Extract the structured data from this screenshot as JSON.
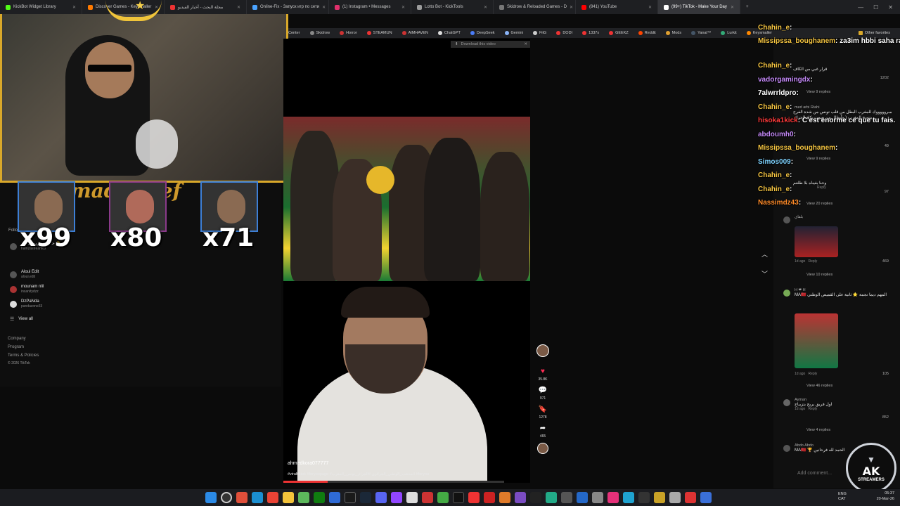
{
  "browser": {
    "tabs": [
      {
        "label": "KickBot Widget Library",
        "color": "#53fc18"
      },
      {
        "label": "Discover Games - Keysmaller",
        "color": "#ff7a00"
      },
      {
        "label": "مجلة البحث - أخبار الفيديو",
        "color": "#e33"
      },
      {
        "label": "Online-Fix - Запуск игр по сети",
        "color": "#4aa3ff"
      },
      {
        "label": "(1) Instagram • Messages",
        "color": "#e1306c"
      },
      {
        "label": "Lotto Bot - KickTools",
        "color": "#9c9c9c"
      },
      {
        "label": "Skidrow & Reloaded Games - D",
        "color": "#777"
      },
      {
        "label": "(841) YouTube",
        "color": "#ff0000"
      },
      {
        "label": "(99+) TikTok - Make Your Day",
        "color": "#ffffff"
      }
    ],
    "new_tab": "+",
    "bookmarks": [
      "Center",
      "Skidrow",
      "Horror",
      "STEAMUN",
      "AIMHAVEN",
      "ChatGPT",
      "DeepSeek",
      "Gemini",
      "FitG",
      "DODI",
      "1337x",
      "GEEKZ",
      "Reddit",
      "Mods",
      "Yanal™",
      "Lurkit",
      "Keysmaller",
      "Other favorites"
    ]
  },
  "tiktok_nav": {
    "following_heading": "Follo",
    "accounts": [
      {
        "name": "حمزة ستريم ستايل ✨",
        "handle": "hamzastreamdz"
      },
      {
        "name": "Aloui Edit",
        "handle": "aloui.edit"
      },
      {
        "name": "mounam nlil",
        "handle": "insanitydzz"
      },
      {
        "name": "DzPaNda",
        "handle": "pandazone33"
      }
    ],
    "view_all": "View all",
    "footer": [
      "Company",
      "Program",
      "Terms & Policies",
      "© 2026 TikTok"
    ]
  },
  "overlay": {
    "banner_text": "mad  areef",
    "multipliers": [
      "x99",
      "x80",
      "x71"
    ]
  },
  "video": {
    "download_banner": "Download this video",
    "author": "ahmedkora077777",
    "caption": "#viraltiktok #foryoupage #المنتخب_الوطني_الجزائري #الجزائر_تونس_المغرب #foryou"
  },
  "actions": {
    "likes": "35.8K",
    "comments": "971",
    "saves": "1278",
    "shares": "465"
  },
  "comments": {
    "items": [
      {
        "text": "قرار غبي من الكاف",
        "likes": "1202",
        "reply": "Reply"
      },
      {
        "text": "",
        "likes": "",
        "reply": "View 9 replies"
      },
      {
        "who": "med arbi Riahi",
        "text": "مبروووووك للمغرب البطل من قلب تونس من شدة الفرح بتتويج المغرب ( وأبطال من صوت بكاء الجزائر",
        "likes": "49",
        "reply": "View 9 replies"
      },
      {
        "text": "وحنا بغيناه بلا طلعم",
        "likes": "97",
        "reply": "Reply"
      },
      {
        "text": "",
        "likes": "",
        "reply": "View 20 replies"
      },
      {
        "who": "بلقاي",
        "text": "",
        "likes": "469",
        "reply": "Reply",
        "time": "1d ago"
      },
      {
        "text": "",
        "likes": "",
        "reply": "View 10 replies"
      },
      {
        "who": "H ❤ H",
        "text": "المهم ديما نجمة ⭐ ثانية على القميص الوطني MA🇲🇦",
        "likes": "105",
        "reply": "Reply",
        "time": "1d ago"
      },
      {
        "text": "",
        "likes": "",
        "reply": "View 46 replies"
      },
      {
        "who": "Ayman",
        "text": "اول فريق يربح بتزبباح",
        "likes": "852",
        "reply": "Reply",
        "time": "1d ago"
      },
      {
        "text": "",
        "likes": "",
        "reply": "View 4 replies"
      },
      {
        "who": "Abdo Abdo",
        "text": "الحمد لله فرحانين 🏆 MA🇲🇦",
        "likes": "",
        "reply": ""
      }
    ],
    "add_placeholder": "Add comment..."
  },
  "chat": [
    {
      "user": "Chahin_e",
      "msg": ":",
      "color": "#f5c542"
    },
    {
      "user": "Missipssa_boughanem",
      "msg": ": za3im hbbi saha rabi yt9bl mnkm siyam w 9iyam",
      "color": "#f5c542"
    },
    {
      "user": "Chahin_e",
      "msg": ":",
      "color": "#f5c542"
    },
    {
      "user": "vadorgamingdx",
      "msg": ":",
      "color": "#c58af9"
    },
    {
      "user": "7alwrrldpro",
      "msg": ":",
      "color": "#ffffff"
    },
    {
      "user": "Chahin_e",
      "msg": ":",
      "color": "#f5c542"
    },
    {
      "user": "hisoka1kick",
      "msg": ": C'est enorme ce que tu fais.",
      "color": "#ff3b3b"
    },
    {
      "user": "abdoumh0",
      "msg": ":",
      "color": "#c58af9"
    },
    {
      "user": "Missipssa_boughanem",
      "msg": ":",
      "color": "#f5c542"
    },
    {
      "user": "Simos009",
      "msg": ":",
      "color": "#7fd3ff"
    },
    {
      "user": "Chahin_e",
      "msg": ":",
      "color": "#f5c542"
    },
    {
      "user": "Chahin_e",
      "msg": ":",
      "color": "#f5c542"
    },
    {
      "user": "Nassimdz43",
      "msg": ":",
      "color": "#ff8c2a"
    }
  ],
  "logo": {
    "main": "AK",
    "sub": "STREAMERS"
  },
  "taskbar": {
    "lang_top": "ENG",
    "lang_bottom": "CAT",
    "time": "05:37",
    "date": "20-Mar-26"
  }
}
